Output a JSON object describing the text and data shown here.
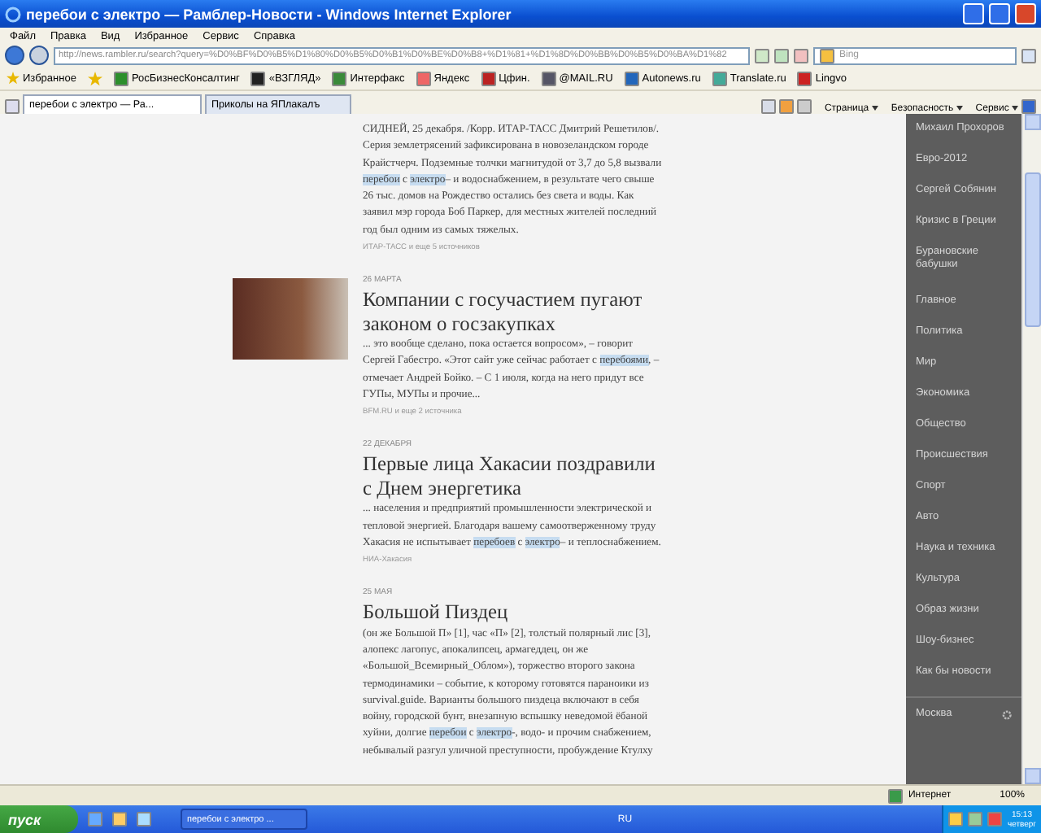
{
  "window": {
    "title": "перебои с электро — Рамблер-Новости - Windows Internet Explorer"
  },
  "menu": [
    "Файл",
    "Правка",
    "Вид",
    "Избранное",
    "Сервис",
    "Справка"
  ],
  "address": {
    "value": "http://news.rambler.ru/search?query=%D0%BF%D0%B5%D1%80%D0%B5%D0%B1%D0%BE%D0%B8+%D1%81+%D1%8D%D0%BB%D0%B5%D0%BA%D1%82"
  },
  "search": {
    "placeholder": "Bing"
  },
  "favorites": {
    "label": "Избранное",
    "links": [
      "РосБизнесКонсалтинг",
      "«ВЗГЛЯД»",
      "Интерфакс",
      "Яндекс",
      "Цфин.",
      "@MAIL.RU",
      "Autonews.ru",
      "Translate.ru",
      "Lingvo"
    ]
  },
  "tabs": [
    {
      "label": "перебои с электро — Ра...",
      "selected": true
    },
    {
      "label": "Приколы на ЯПлакалъ",
      "selected": false
    }
  ],
  "command_bar": [
    "Страница",
    "Безопасность",
    "Сервис"
  ],
  "articles": [
    {
      "image": false,
      "body": [
        {
          "text": "СИДНЕЙ, 25 декабря. /Корр. ИТАР-ТАСС Дмитрий Решетилов/. Серия землетрясений зафиксирована в новозеландском городе Крайстчерч. Подземные толчки магнитудой от 3,7 до 5,8 вызвали ",
          "highlight": false
        },
        {
          "text": "перебои",
          "highlight": true
        },
        {
          "text": " с ",
          "highlight": false
        },
        {
          "text": "электро",
          "highlight": true
        },
        {
          "text": "– и водоснабжением, в результате чего свыше 26 тыс. домов на Рождество остались без света и воды. Как заявил мэр города Боб Паркер, для местных жителей последний год был одним из самых тяжелых.",
          "highlight": false
        }
      ],
      "source": "ИТАР-ТАСС и еще 5 источников"
    },
    {
      "image": true,
      "date": "26 МАРТА",
      "title": "Компании с госучастием пугают законом о госзакупках",
      "body": [
        {
          "text": "... это вообще сделано, пока остается вопросом», – говорит Сергей Габестро. «Этот сайт уже сейчас работает с ",
          "highlight": false
        },
        {
          "text": "перебоями",
          "highlight": true
        },
        {
          "text": ", – отмечает Андрей Бойко. – С 1 июля, когда на него придут все ГУПы, МУПы и прочие...",
          "highlight": false
        }
      ],
      "source": "BFM.RU и еще 2 источника"
    },
    {
      "image": false,
      "date": "22 ДЕКАБРЯ",
      "title": "Первые лица Хакасии поздравили с Днем энергетика",
      "body": [
        {
          "text": "... населения и предприятий промышленности электрической и тепловой энергией. Благодаря вашему самоотверженному труду Хакасия не испытывает ",
          "highlight": false
        },
        {
          "text": "перебоев",
          "highlight": true
        },
        {
          "text": " с ",
          "highlight": false
        },
        {
          "text": "электро",
          "highlight": true
        },
        {
          "text": "– и теплоснабжением.",
          "highlight": false
        }
      ],
      "source": "НИА-Хакасия"
    },
    {
      "image": false,
      "date": "25 МАЯ",
      "title": "Большой Пиздец",
      "body": [
        {
          "text": "(он же Большой П» [1], час «П» [2], толстый полярный лис [3], алопекс лагопус, апокалипсец, армагеддец, он же «Большой_Всемирный_Облом»), торжество второго закона термодинамики – событие, к которому готовятся параноики из survival.guide. Варианты большого пиздеца включают в себя войну, городской бунт, внезапную вспышку неведомой ёбаной хуйни, долгие ",
          "highlight": false
        },
        {
          "text": "перебои",
          "highlight": true
        },
        {
          "text": " с ",
          "highlight": false
        },
        {
          "text": "электро",
          "highlight": true
        },
        {
          "text": "-, водо- и прочим снабжением, небывалый разгул уличной преступности, пробуждение Ктулху",
          "highlight": false
        }
      ]
    }
  ],
  "sidebar": {
    "groups": [
      [
        "Михаил Прохоров",
        "Евро-2012",
        "Сергей Собянин",
        "Кризис в Греции",
        "Бурановские бабушки"
      ],
      [
        "Главное",
        "Политика",
        "Мир",
        "Экономика",
        "Общество",
        "Происшествия",
        "Спорт",
        "Авто",
        "Наука и техника",
        "Культура",
        "Образ жизни",
        "Шоу-бизнес",
        "Как бы новости"
      ]
    ],
    "footer": "Москва"
  },
  "status_bar": {
    "zone": "Интернет",
    "zoom": "100%"
  },
  "taskbar": {
    "start": "пуск",
    "window": "перебои с электро ...",
    "language": "RU",
    "time": "15:13",
    "day": "четверг"
  }
}
